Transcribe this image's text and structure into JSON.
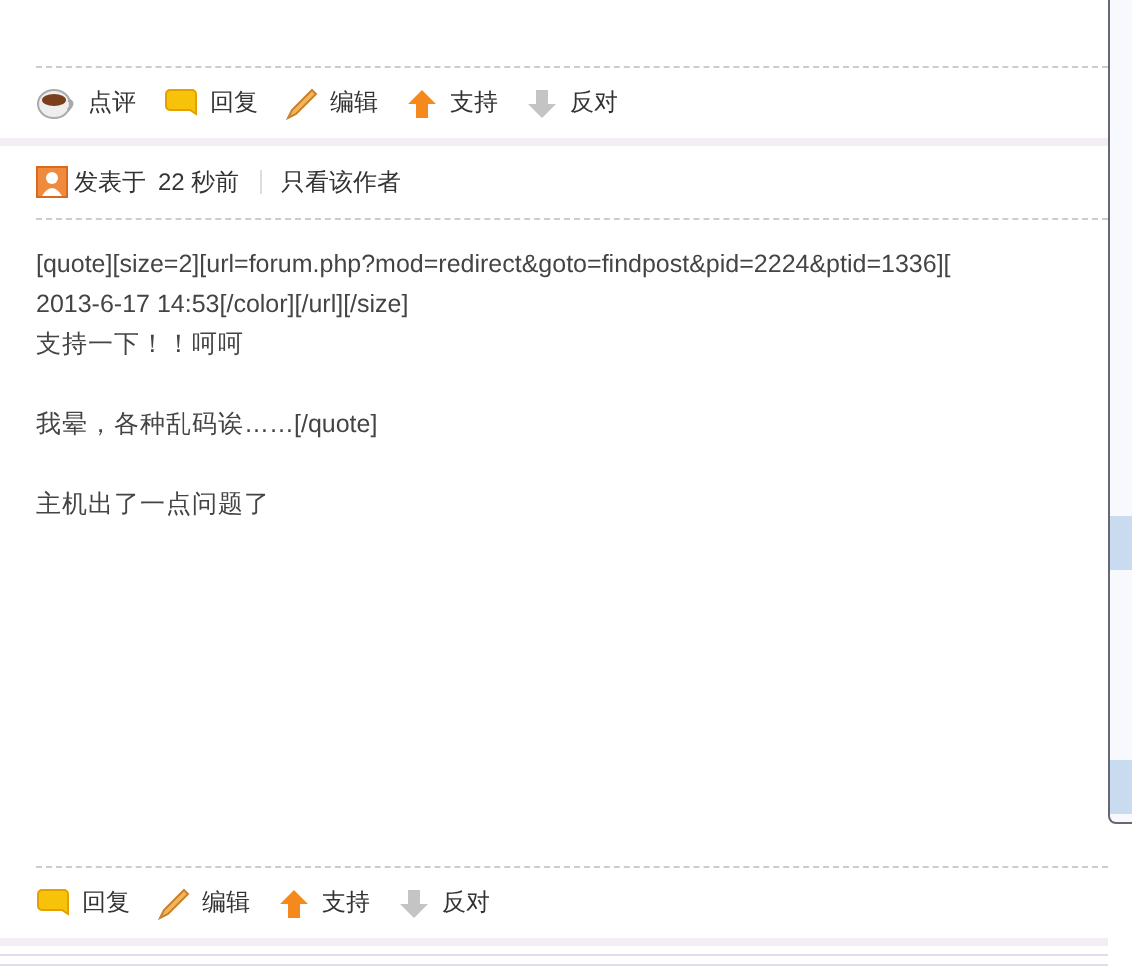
{
  "top_actions": [
    {
      "kind": "comment",
      "label": "点评"
    },
    {
      "kind": "reply",
      "label": "回复"
    },
    {
      "kind": "edit",
      "label": "编辑"
    },
    {
      "kind": "support",
      "label": "支持"
    },
    {
      "kind": "oppose",
      "label": "反对"
    }
  ],
  "post_meta": {
    "posted_label": "发表于",
    "time": "22 秒前",
    "author_only": "只看该作者"
  },
  "content": [
    [
      "[quote][size=2][url=forum.php?mod=redirect&goto=findpost&pid=2224&ptid=1336][",
      "2013-6-17 14:53[/color][/url][/size]",
      "支持一下！！呵呵"
    ],
    [
      "我晕，各种乱码诶……[/quote]"
    ],
    [
      "主机出了一点问题了"
    ]
  ],
  "bottom_actions": [
    {
      "kind": "reply",
      "label": "回复"
    },
    {
      "kind": "edit",
      "label": "编辑"
    },
    {
      "kind": "support",
      "label": "支持"
    },
    {
      "kind": "oppose",
      "label": "反对"
    }
  ]
}
